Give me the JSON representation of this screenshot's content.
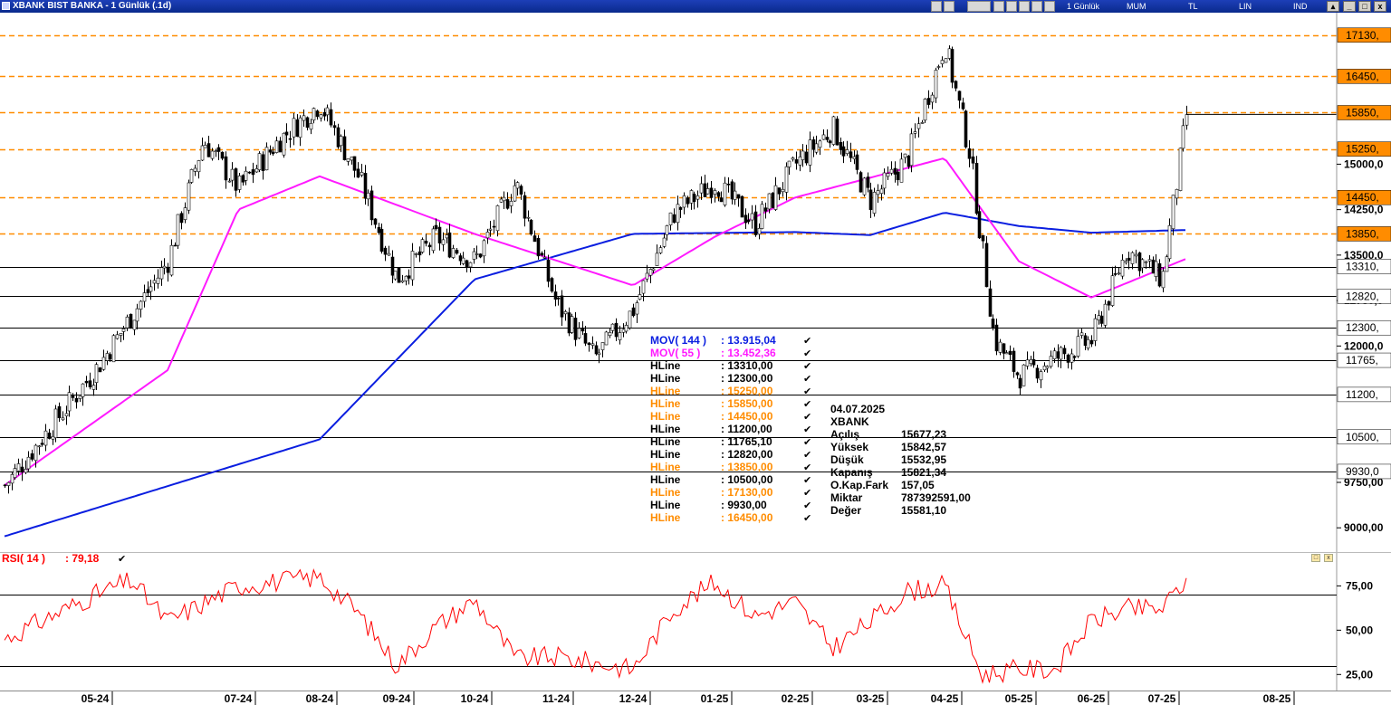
{
  "window": {
    "title": "XBANK BIST BANKA - 1 Günlük (.1d)",
    "toolbar": {
      "period": "1 Günlük",
      "chart_style": "MUM",
      "currency": "TL",
      "scale": "LIN",
      "indicator": "IND"
    }
  },
  "colors": {
    "mov144": "#0a1ee0",
    "mov55": "#ff1aff",
    "hline_black": "#000000",
    "hline_orange": "#ff8c00",
    "rsi": "#ff0000",
    "candle_up": "#ffffff",
    "candle_down": "#000000"
  },
  "legend": {
    "entries": [
      {
        "name": "MOV( 144 )",
        "value": ": 13.915,04",
        "color": "#0a1ee0"
      },
      {
        "name": "MOV( 55 )",
        "value": ": 13.452,36",
        "color": "#ff1aff"
      },
      {
        "name": "HLine",
        "value": ": 13310,00",
        "color": "#000000"
      },
      {
        "name": "HLine",
        "value": ": 12300,00",
        "color": "#000000"
      },
      {
        "name": "HLine",
        "value": ": 15250,00",
        "color": "#ff8c00"
      },
      {
        "name": "HLine",
        "value": ": 15850,00",
        "color": "#ff8c00"
      },
      {
        "name": "HLine",
        "value": ": 14450,00",
        "color": "#ff8c00"
      },
      {
        "name": "HLine",
        "value": ": 11200,00",
        "color": "#000000"
      },
      {
        "name": "HLine",
        "value": ": 11765,10",
        "color": "#000000"
      },
      {
        "name": "HLine",
        "value": ": 12820,00",
        "color": "#000000"
      },
      {
        "name": "HLine",
        "value": ": 13850,00",
        "color": "#ff8c00"
      },
      {
        "name": "HLine",
        "value": ": 10500,00",
        "color": "#000000"
      },
      {
        "name": "HLine",
        "value": ": 17130,00",
        "color": "#ff8c00"
      },
      {
        "name": "HLine",
        "value": ": 9930,00",
        "color": "#000000"
      },
      {
        "name": "HLine",
        "value": ": 16450,00",
        "color": "#ff8c00"
      }
    ]
  },
  "info_box": {
    "date": "04.07.2025",
    "symbol": "XBANK",
    "rows": [
      {
        "label": "Açılış",
        "value": "15677,23"
      },
      {
        "label": "Yüksek",
        "value": "15842,57"
      },
      {
        "label": "Düşük",
        "value": "15532,95"
      },
      {
        "label": "Kapanış",
        "value": "15821,34"
      },
      {
        "label": "O.Kap.Fark",
        "value": "157,05"
      },
      {
        "label": "Miktar",
        "value": "787392591,00"
      },
      {
        "label": "Değer",
        "value": "15581,10"
      }
    ]
  },
  "rsi": {
    "label": "RSI( 14 )",
    "value": ": 79,18",
    "axis_ticks": [
      "75,00",
      "50,00",
      "25,00"
    ]
  },
  "price_axis": {
    "ticks": [
      "15000,0",
      "14250,0",
      "13500,0",
      "12750,0",
      "12000,0",
      "9750,00",
      "9000,00"
    ],
    "hline_labels": [
      {
        "label": "17130,",
        "value": 17130,
        "color": "#ff8c00"
      },
      {
        "label": "16450,",
        "value": 16450,
        "color": "#ff8c00"
      },
      {
        "label": "15850,",
        "value": 15850,
        "color": "#ff8c00"
      },
      {
        "label": "15250,",
        "value": 15250,
        "color": "#ff8c00"
      },
      {
        "label": "14450,",
        "value": 14450,
        "color": "#ff8c00"
      },
      {
        "label": "13850,",
        "value": 13850,
        "color": "#ff8c00"
      },
      {
        "label": "13310,",
        "value": 13310,
        "color": "#000000"
      },
      {
        "label": "12820,",
        "value": 12820,
        "color": "#000000"
      },
      {
        "label": "12300,",
        "value": 12300,
        "color": "#000000"
      },
      {
        "label": "11765,",
        "value": 11765,
        "color": "#000000"
      },
      {
        "label": "11200,",
        "value": 11200,
        "color": "#000000"
      },
      {
        "label": "10500,",
        "value": 10500,
        "color": "#000000"
      },
      {
        "label": "9930,0",
        "value": 9930,
        "color": "#000000"
      }
    ]
  },
  "date_axis": [
    "05-24",
    "07-24",
    "08-24",
    "09-24",
    "10-24",
    "11-24",
    "12-24",
    "01-25",
    "02-25",
    "03-25",
    "04-25",
    "05-25",
    "06-25",
    "07-25",
    "08-25"
  ],
  "chart_data": {
    "type": "candlestick",
    "title": "XBANK BIST BANKA - 1 Günlük (.1d)",
    "x_ticks": [
      "05-24",
      "07-24",
      "08-24",
      "09-24",
      "10-24",
      "11-24",
      "12-24",
      "01-25",
      "02-25",
      "03-25",
      "04-25",
      "05-25",
      "06-25",
      "07-25",
      "08-25"
    ],
    "ylim": [
      8600,
      17500
    ],
    "close_path": [
      [
        "04-24",
        9700
      ],
      [
        "05-24",
        11600
      ],
      [
        "06-24",
        13400
      ],
      [
        "06-24",
        15400
      ],
      [
        "07-24",
        14600
      ],
      [
        "07-24",
        15400
      ],
      [
        "08-24",
        16000
      ],
      [
        "08-24",
        14800
      ],
      [
        "09-24",
        13100
      ],
      [
        "09-24",
        13800
      ],
      [
        "10-24",
        13400
      ],
      [
        "10-24",
        14700
      ],
      [
        "11-24",
        12700
      ],
      [
        "11-24",
        11800
      ],
      [
        "12-24",
        12600
      ],
      [
        "12-24",
        14200
      ],
      [
        "01-25",
        14700
      ],
      [
        "01-25",
        14000
      ],
      [
        "02-25",
        15000
      ],
      [
        "02-25",
        15600
      ],
      [
        "03-25",
        14400
      ],
      [
        "03-25",
        15100
      ],
      [
        "04-25",
        17000
      ],
      [
        "04-25",
        15200
      ],
      [
        "04-25",
        12100
      ],
      [
        "05-25",
        11500
      ],
      [
        "05-25",
        11800
      ],
      [
        "06-25",
        12100
      ],
      [
        "06-25",
        13600
      ],
      [
        "07-25",
        13100
      ],
      [
        "07-25",
        15821.34
      ]
    ],
    "last_bar": {
      "date": "04.07.2025",
      "open": 15677.23,
      "high": 15842.57,
      "low": 15532.95,
      "close": 15821.34
    },
    "moving_averages": [
      {
        "name": "MOV( 144 )",
        "last": 13915.04,
        "points": [
          [
            "04-24",
            8860
          ],
          [
            "08-24",
            10460
          ],
          [
            "10-24",
            13100
          ],
          [
            "12-24",
            13850
          ],
          [
            "02-25",
            13880
          ],
          [
            "03-25",
            13830
          ],
          [
            "04-25",
            14200
          ],
          [
            "05-25",
            13980
          ],
          [
            "06-25",
            13870
          ],
          [
            "07-25",
            13915.04
          ]
        ]
      },
      {
        "name": "MOV( 55 )",
        "last": 13452.36,
        "points": [
          [
            "04-24",
            9700
          ],
          [
            "06-24",
            11600
          ],
          [
            "07-24",
            14250
          ],
          [
            "08-24",
            14800
          ],
          [
            "10-24",
            13850
          ],
          [
            "12-24",
            13000
          ],
          [
            "01-25",
            13800
          ],
          [
            "02-25",
            14450
          ],
          [
            "04-25",
            15100
          ],
          [
            "05-25",
            13400
          ],
          [
            "06-25",
            12800
          ],
          [
            "07-25",
            13452.36
          ]
        ]
      }
    ],
    "hlines": [
      17130,
      16450,
      15850,
      15250,
      14450,
      13850,
      13310,
      12820,
      12300,
      11765.1,
      11200,
      10500,
      9930
    ],
    "rsi": {
      "name": "RSI( 14 )",
      "last": 79.18,
      "ylim": [
        18,
        90
      ],
      "levels": [
        70,
        30
      ],
      "points": [
        [
          "04-24",
          45
        ],
        [
          "05-24",
          70
        ],
        [
          "05-24",
          78
        ],
        [
          "06-24",
          55
        ],
        [
          "07-24",
          75
        ],
        [
          "08-24",
          80
        ],
        [
          "08-24",
          60
        ],
        [
          "09-24",
          30
        ],
        [
          "09-24",
          52
        ],
        [
          "10-24",
          67
        ],
        [
          "10-24",
          34
        ],
        [
          "11-24",
          35
        ],
        [
          "12-24",
          28
        ],
        [
          "12-24",
          62
        ],
        [
          "01-25",
          77
        ],
        [
          "01-25",
          58
        ],
        [
          "02-25",
          66
        ],
        [
          "02-25",
          40
        ],
        [
          "03-25",
          55
        ],
        [
          "03-25",
          72
        ],
        [
          "04-25",
          75
        ],
        [
          "04-25",
          25
        ],
        [
          "05-25",
          28
        ],
        [
          "05-25",
          28
        ],
        [
          "06-25",
          55
        ],
        [
          "06-25",
          62
        ],
        [
          "07-25",
          62
        ],
        [
          "07-25",
          80
        ]
      ]
    }
  }
}
